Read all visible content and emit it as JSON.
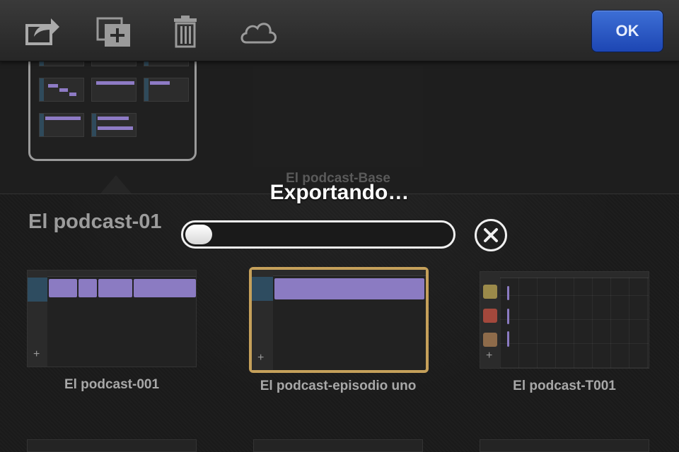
{
  "toolbar": {
    "icons": [
      "share-icon",
      "new-project-icon",
      "trash-icon",
      "cloud-icon"
    ],
    "ok_label": "OK"
  },
  "upper": {
    "faded_project_title": "El podcast-Base"
  },
  "section": {
    "title": "El podcast-01"
  },
  "export": {
    "title": "Exportando…",
    "progress": 0.1
  },
  "projects": [
    {
      "name": "El podcast-001"
    },
    {
      "name": "El podcast-episodio uno"
    },
    {
      "name": "El podcast-T001"
    }
  ],
  "colors": {
    "ok_button": "#2b5bc6",
    "track": "#8b7bc2",
    "selected_border": "#c5a05a"
  }
}
